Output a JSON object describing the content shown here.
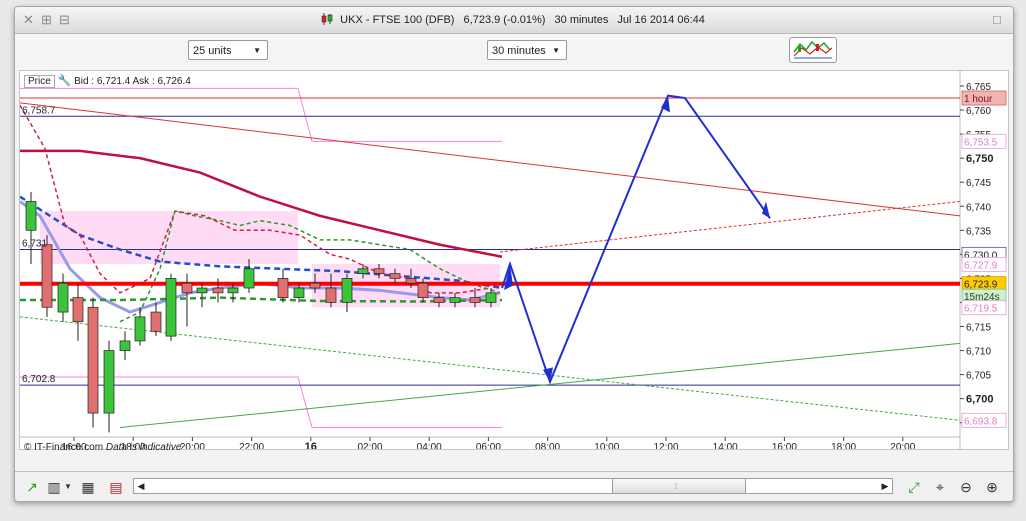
{
  "window": {
    "title_symbol": "UKX - FTSE 100 (DFB)",
    "title_price": "6,723.9 (-0.01%)",
    "title_interval": "30 minutes",
    "title_date": "Jul 16 2014 06:44"
  },
  "toolbar": {
    "units_select": "25 units",
    "interval_select": "30 minutes"
  },
  "info": {
    "price_label": "Price",
    "bid_ask": "Bid : 6,721.4 Ask : 6,726.4"
  },
  "footer": {
    "copyright": "© IT-Finance.com",
    "disclaimer": "Data is indicative"
  },
  "chart_data": {
    "type": "candlestick",
    "y_ticks": [
      "6,765",
      "6,760",
      "6,755",
      "6,750",
      "6,745",
      "6,740",
      "6,735",
      "6,730",
      "6,725",
      "6,720",
      "6,715",
      "6,710",
      "6,705",
      "6,700",
      "6,695"
    ],
    "bold_ticks": [
      "6,750",
      "6,700"
    ],
    "ylim": [
      6693,
      6768
    ],
    "x_ticks": [
      "16:00",
      "18:00",
      "20:00",
      "22:00",
      "16",
      "02:00",
      "04:00",
      "06:00",
      "08:00",
      "10:00",
      "12:00",
      "14:00",
      "16:00",
      "18:00",
      "20:00"
    ],
    "bold_x_ticks": [
      "16"
    ],
    "level_labels_left": [
      {
        "text": "6,758.7",
        "value": 6758.7
      },
      {
        "text": "6,731",
        "value": 6731
      },
      {
        "text": "6,702.8",
        "value": 6702.8
      }
    ],
    "right_tags": [
      {
        "text": "1 hour",
        "value": 6762.5,
        "bg": "#f3b4b4",
        "fg": "#7a1010",
        "border": "#d06060"
      },
      {
        "text": "6,753.5",
        "value": 6753.5,
        "bg": "#ffffff",
        "fg": "#e080c8",
        "border": "#e0a0d8"
      },
      {
        "text": "6,730.0",
        "value": 6730.0,
        "bg": "#ffffff",
        "fg": "#222222",
        "border": "#555599"
      },
      {
        "text": "6,727.9",
        "value": 6727.9,
        "bg": "#ffffff",
        "fg": "#e080c8",
        "border": "#e0a0d8"
      },
      {
        "text": "6,723.9",
        "value": 6723.9,
        "bg": "#ffcc00",
        "fg": "#222222",
        "border": "#cc9900"
      },
      {
        "text": "15m24s",
        "value": 6721.3,
        "bg": "#cff0cf",
        "fg": "#224422",
        "border": "#88bb88"
      },
      {
        "text": "6,719.5",
        "value": 6718.9,
        "bg": "#ffffff",
        "fg": "#e080c8",
        "border": "#e0a0d8"
      },
      {
        "text": "6,693.8",
        "value": 6695.5,
        "bg": "#ffffff",
        "fg": "#e080c8",
        "border": "#e0a0d8"
      }
    ],
    "candles": [
      {
        "x": 6,
        "o": 6735,
        "h": 6743,
        "l": 6728,
        "c": 6741
      },
      {
        "x": 22,
        "o": 6732,
        "h": 6734,
        "l": 6717,
        "c": 6719
      },
      {
        "x": 38,
        "o": 6718,
        "h": 6726,
        "l": 6716,
        "c": 6724
      },
      {
        "x": 53,
        "o": 6721,
        "h": 6724,
        "l": 6712,
        "c": 6716
      },
      {
        "x": 68,
        "o": 6719,
        "h": 6721,
        "l": 6694,
        "c": 6697
      },
      {
        "x": 84,
        "o": 6697,
        "h": 6712,
        "l": 6693,
        "c": 6710
      },
      {
        "x": 100,
        "o": 6710,
        "h": 6714,
        "l": 6708,
        "c": 6712
      },
      {
        "x": 115,
        "o": 6712,
        "h": 6719,
        "l": 6711,
        "c": 6717
      },
      {
        "x": 131,
        "o": 6718,
        "h": 6720,
        "l": 6713,
        "c": 6714
      },
      {
        "x": 146,
        "o": 6713,
        "h": 6726,
        "l": 6712,
        "c": 6725
      },
      {
        "x": 162,
        "o": 6724,
        "h": 6726,
        "l": 6715,
        "c": 6722
      },
      {
        "x": 177,
        "o": 6722,
        "h": 6724,
        "l": 6719,
        "c": 6723
      },
      {
        "x": 193,
        "o": 6723,
        "h": 6725,
        "l": 6720,
        "c": 6722
      },
      {
        "x": 208,
        "o": 6722,
        "h": 6724,
        "l": 6720,
        "c": 6723
      },
      {
        "x": 224,
        "o": 6723,
        "h": 6729,
        "l": 6722,
        "c": 6727
      },
      {
        "x": 258,
        "o": 6725,
        "h": 6727,
        "l": 6720,
        "c": 6721
      },
      {
        "x": 274,
        "o": 6721,
        "h": 6724,
        "l": 6720,
        "c": 6723
      },
      {
        "x": 290,
        "o": 6724,
        "h": 6726,
        "l": 6722,
        "c": 6723
      },
      {
        "x": 306,
        "o": 6723,
        "h": 6726,
        "l": 6719,
        "c": 6720
      },
      {
        "x": 322,
        "o": 6720,
        "h": 6726,
        "l": 6718,
        "c": 6725
      },
      {
        "x": 338,
        "o": 6726,
        "h": 6728,
        "l": 6725,
        "c": 6727
      },
      {
        "x": 354,
        "o": 6727,
        "h": 6728,
        "l": 6725,
        "c": 6726
      },
      {
        "x": 370,
        "o": 6726,
        "h": 6727,
        "l": 6724,
        "c": 6725
      },
      {
        "x": 386,
        "o": 6725,
        "h": 6727,
        "l": 6723,
        "c": 6724
      },
      {
        "x": 398,
        "o": 6724,
        "h": 6725,
        "l": 6720,
        "c": 6721
      },
      {
        "x": 414,
        "o": 6721,
        "h": 6722,
        "l": 6719,
        "c": 6720
      },
      {
        "x": 430,
        "o": 6720,
        "h": 6722,
        "l": 6719,
        "c": 6721
      },
      {
        "x": 450,
        "o": 6721,
        "h": 6723,
        "l": 6719,
        "c": 6720
      },
      {
        "x": 466,
        "o": 6720,
        "h": 6723,
        "l": 6719,
        "c": 6722
      }
    ],
    "colors": {
      "up": "#3cc43c",
      "down": "#e07070",
      "candle_border": "#222222",
      "last_price_line": "#ff0000",
      "level_line": "#2a2a9a",
      "trend_red": "#e03030",
      "trend_green": "#44aa44",
      "ma_red": "#c01040",
      "ma_blue": "#2050d0",
      "ma_lilac": "#9a9ae8",
      "ma_green": "#2a9a2a",
      "envelope": "#ff80e0",
      "projection": "#2030d0"
    }
  },
  "colors": {
    "background": "#ffffff",
    "frame": "#f3f3f3"
  }
}
